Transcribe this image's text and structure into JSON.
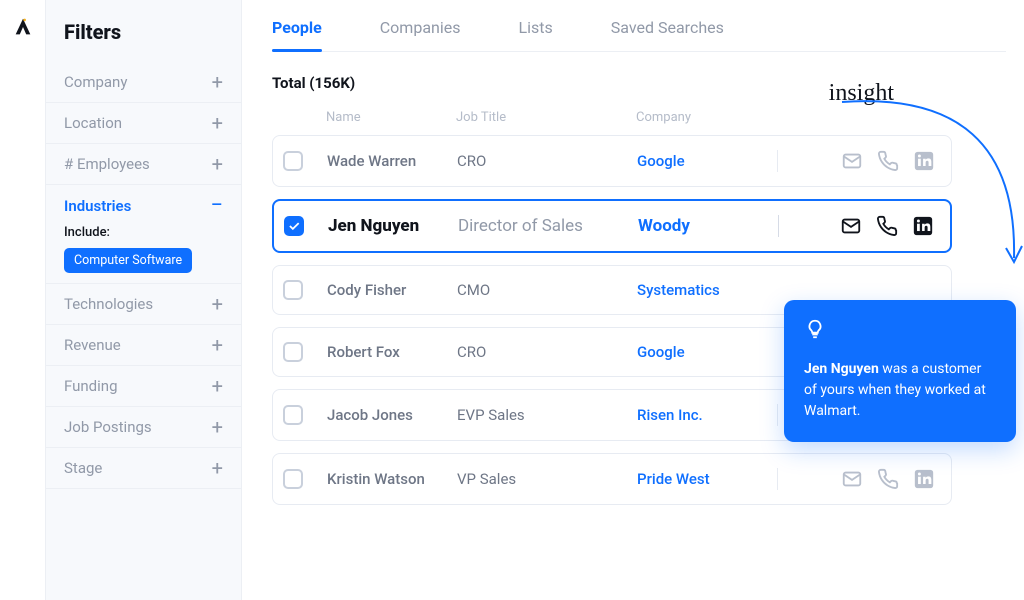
{
  "sidebar": {
    "title": "Filters",
    "items": [
      {
        "label": "Company",
        "expanded": false
      },
      {
        "label": "Location",
        "expanded": false
      },
      {
        "label": "# Employees",
        "expanded": false
      },
      {
        "label": "Industries",
        "expanded": true,
        "include_label": "Include:",
        "chip": "Computer Software"
      },
      {
        "label": "Technologies",
        "expanded": false
      },
      {
        "label": "Revenue",
        "expanded": false
      },
      {
        "label": "Funding",
        "expanded": false
      },
      {
        "label": "Job Postings",
        "expanded": false
      },
      {
        "label": "Stage",
        "expanded": false
      }
    ]
  },
  "tabs": [
    "People",
    "Companies",
    "Lists",
    "Saved Searches"
  ],
  "active_tab": "People",
  "total_label": "Total (156K)",
  "columns": {
    "name": "Name",
    "job": "Job Title",
    "company": "Company"
  },
  "rows": [
    {
      "selected": false,
      "name": "Wade Warren",
      "job": "CRO",
      "company": "Google"
    },
    {
      "selected": true,
      "name": "Jen Nguyen",
      "job": "Director of Sales",
      "company": "Woody"
    },
    {
      "selected": false,
      "name": "Cody Fisher",
      "job": "CMO",
      "company": "Systematics"
    },
    {
      "selected": false,
      "name": "Robert Fox",
      "job": "CRO",
      "company": "Google"
    },
    {
      "selected": false,
      "name": "Jacob Jones",
      "job": "EVP Sales",
      "company": "Risen Inc."
    },
    {
      "selected": false,
      "name": "Kristin Watson",
      "job": "VP Sales",
      "company": "Pride West"
    }
  ],
  "insight": {
    "handwritten": "insight",
    "text_prefix": "Jen Nguyen",
    "text_rest": " was a customer of yours when they worked at Walmart."
  }
}
